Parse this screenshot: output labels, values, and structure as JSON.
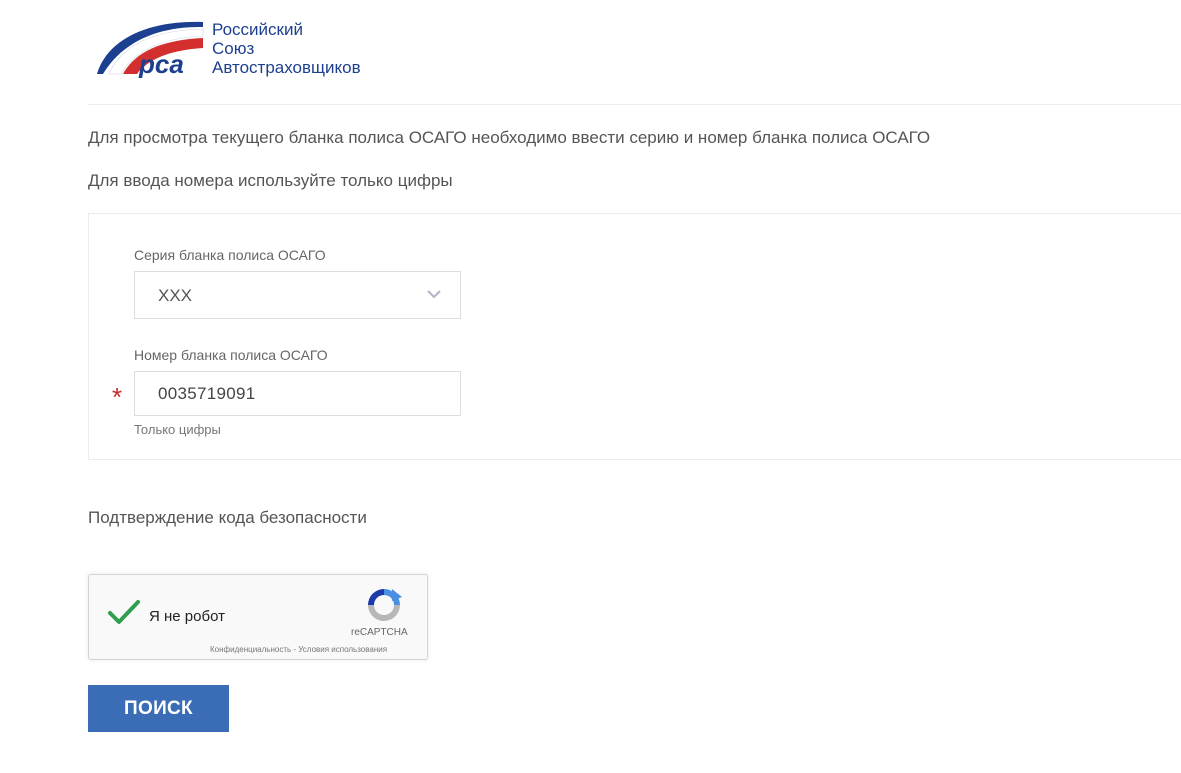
{
  "logo": {
    "mark_text": "рса",
    "line1": "Российский",
    "line2": "Союз",
    "line3": "Автостраховщиков"
  },
  "intro": {
    "line1": "Для просмотра текущего бланка полиса ОСАГО необходимо ввести серию и номер бланка полиса ОСАГО",
    "line2": "Для ввода номера используйте только цифры"
  },
  "form": {
    "series_label": "Серия бланка полиса ОСАГО",
    "series_value": "XXX",
    "number_label": "Номер бланка полиса ОСАГО",
    "number_value": "0035719091",
    "required_mark": "*",
    "number_hint": "Только цифры"
  },
  "captcha": {
    "section_title": "Подтверждение кода безопасности",
    "checkbox_label": "Я не робот",
    "brand": "reCAPTCHA",
    "links": "Конфиденциальность - Условия использования",
    "checked": true
  },
  "actions": {
    "search_label": "ПОИСК"
  },
  "colors": {
    "brand_blue": "#1d3f8f",
    "button_blue": "#3b6db7",
    "required_red": "#c62828",
    "check_green": "#2e9f4f"
  }
}
